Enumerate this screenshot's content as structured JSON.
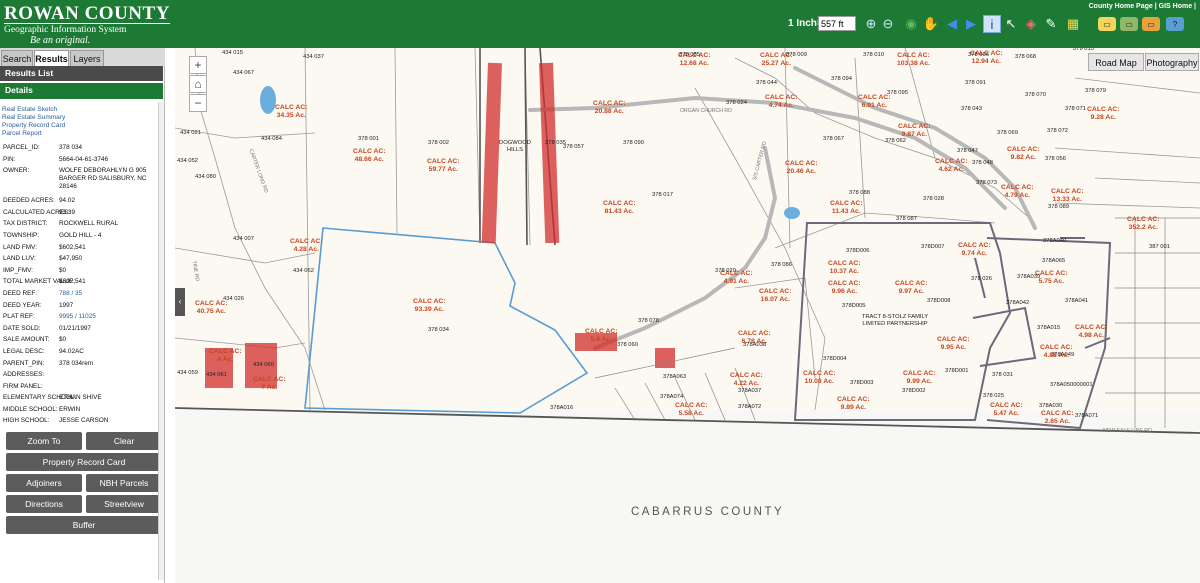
{
  "header": {
    "logo_line1": "ROWAN COUNTY",
    "logo_line2": "Geographic Information System",
    "logo_line3": "Be an original.",
    "top_links": "County Home Page | GIS Home |",
    "scale_label": "1 Inch=",
    "scale_value": "557 ft"
  },
  "toolbar": [
    {
      "name": "zoom-in-icon",
      "glyph": "⊕",
      "color": "#cfe8ff"
    },
    {
      "name": "zoom-out-icon",
      "glyph": "⊖",
      "color": "#cfe8ff"
    },
    {
      "name": "globe-icon",
      "glyph": "◉",
      "color": "#5fb85f"
    },
    {
      "name": "pan-hand-icon",
      "glyph": "✋",
      "color": "#fff"
    },
    {
      "name": "back-arrow-icon",
      "glyph": "◀",
      "color": "#3f8fe8"
    },
    {
      "name": "forward-arrow-icon",
      "glyph": "▶",
      "color": "#3f8fe8"
    },
    {
      "name": "identify-icon",
      "glyph": "i",
      "color": "#1a4f8c"
    },
    {
      "name": "select-arrow-icon",
      "glyph": "↖",
      "color": "#fff"
    },
    {
      "name": "eraser-icon",
      "glyph": "◈",
      "color": "#ff6b6b"
    },
    {
      "name": "pencil-icon",
      "glyph": "✎",
      "color": "#fff"
    },
    {
      "name": "map-icon",
      "glyph": "▦",
      "color": "#ffd24a"
    }
  ],
  "tabs": [
    "Search",
    "Results",
    "Layers"
  ],
  "panel": {
    "results_list": "Results List",
    "details": "Details",
    "links": [
      "Real Estate Sketch",
      "Real Estate Summary",
      "Property Record Card",
      "Parcel Report"
    ]
  },
  "attributes": [
    {
      "k": "PARCEL_ID:",
      "v": "378 034"
    },
    {
      "k": "PIN:",
      "v": "5664-04-61-3746"
    },
    {
      "k": "OWNER:",
      "v": "WOLFE DEBORAHLYN G 905 BARGER RD SALISBURY, NC 28146",
      "tall": true
    },
    {
      "k": "DEEDED ACRES:",
      "v": "94.02"
    },
    {
      "k": "CALCULATED ACRES:",
      "v": "93.39"
    },
    {
      "k": "TAX DISTRICT:",
      "v": "ROCKWELL RURAL"
    },
    {
      "k": "TOWNSHIP:",
      "v": "GOLD HILL - 4"
    },
    {
      "k": "LAND FMV:",
      "v": "$602,541"
    },
    {
      "k": "LAND LUV:",
      "v": "$47,950"
    },
    {
      "k": "IMP_FMV:",
      "v": "$0"
    },
    {
      "k": "TOTAL MARKET VALUE:",
      "v": "$602,541"
    },
    {
      "k": "DEED REF:",
      "v": "788 / 35",
      "link": true
    },
    {
      "k": "DEED YEAR:",
      "v": "1997"
    },
    {
      "k": "PLAT REF:",
      "v": "9995 / 11025",
      "link": true
    },
    {
      "k": "DATE SOLD:",
      "v": "01/21/1997"
    },
    {
      "k": "SALE AMOUNT:",
      "v": "$0"
    },
    {
      "k": "LEGAL DESC:",
      "v": "94.02AC"
    },
    {
      "k": "PARENT_PIN:",
      "v": "378 034rem"
    },
    {
      "k": "ADDRESSES:",
      "v": ""
    },
    {
      "k": "FIRM PANEL:",
      "v": ""
    },
    {
      "k": "ELEMENTARY SCHOOL:",
      "v": "ETHAN SHIVE"
    },
    {
      "k": "MIDDLE SCHOOL:",
      "v": "ERWIN"
    },
    {
      "k": "HIGH SCHOOL:",
      "v": "JESSE CARSON"
    }
  ],
  "buttons": {
    "zoom_to": "Zoom To",
    "clear": "Clear",
    "property_record_card": "Property Record Card",
    "adjoiners": "Adjoiners",
    "nbh_parcels": "NBH Parcels",
    "directions": "Directions",
    "streetview": "Streetview",
    "buffer": "Buffer"
  },
  "basemap": {
    "road": "Road Map",
    "photo": "Photography"
  },
  "map": {
    "county": "CABARRUS COUNTY",
    "dogwood": "DOGWOOD HILLS",
    "tract": "TRACT 8-STOLZ FAMILY LIMITED PARTNERSHIP",
    "calc": [
      [
        "CALC AC:",
        "12.68 Ac."
      ],
      [
        "CALC AC:",
        "25.27 Ac."
      ],
      [
        "CALC AC:",
        "103.38 Ac."
      ],
      [
        "CALC AC:",
        "12.94 Ac."
      ],
      [
        "CALC AC:",
        "34.35 Ac."
      ],
      [
        "CALC AC:",
        "48.66 Ac."
      ],
      [
        "CALC AC:",
        "59.77 Ac."
      ],
      [
        "CALC AC:",
        "20.88 Ac."
      ],
      [
        "CALC AC:",
        "4.74 Ac."
      ],
      [
        "CALC AC:",
        "6.91 Ac."
      ],
      [
        "CALC AC:",
        "9.87 Ac."
      ],
      [
        "CALC AC:",
        "9.28 Ac."
      ],
      [
        "CALC AC:",
        "9.82 Ac."
      ],
      [
        "CALC AC:",
        "20.46 Ac."
      ],
      [
        "CALC AC:",
        "4.62 Ac."
      ],
      [
        "CALC AC:",
        "81.43 Ac."
      ],
      [
        "CALC AC:",
        "11.43 Ac."
      ],
      [
        "CALC AC:",
        "4.79 Ac."
      ],
      [
        "CALC AC:",
        "13.33 Ac."
      ],
      [
        "CALC AC:",
        "352.2 Ac."
      ],
      [
        "CALC AC:",
        "4.28 Ac."
      ],
      [
        "CALC AC:",
        "10.37 Ac."
      ],
      [
        "CALC AC:",
        "9.74 Ac."
      ],
      [
        "CALC AC:",
        "4.91 Ac."
      ],
      [
        "CALC AC:",
        "9.96 Ac."
      ],
      [
        "CALC AC:",
        "9.97 Ac."
      ],
      [
        "CALC AC:",
        "5.75 Ac."
      ],
      [
        "CALC AC:",
        "16.07 Ac."
      ],
      [
        "CALC AC:",
        "40.75 Ac."
      ],
      [
        "CALC AC:",
        "93.39 Ac."
      ],
      [
        "CALC AC:",
        "4.98 Ac."
      ],
      [
        "CALC AC:",
        "6.78 Ac."
      ],
      [
        "CALC AC:",
        "9.95 Ac."
      ],
      [
        "CALC AC:",
        "4.88 Ac."
      ],
      [
        "CALC AC:",
        "4 Ac."
      ],
      [
        "CALC AC:",
        "7 Ac."
      ],
      [
        "CALC AC:",
        "4.22 Ac."
      ],
      [
        "CALC AC:",
        "10.08 Ac."
      ],
      [
        "CALC AC:",
        "9.99 Ac."
      ],
      [
        "CALC AC:",
        "5.58 Ac."
      ],
      [
        "CALC AC:",
        "9.89 Ac."
      ],
      [
        "CALC AC:",
        "5.47 Ac."
      ],
      [
        "CALC AC:",
        "2.65 Ac."
      ],
      [
        "CALC AC:",
        "5.4 Ac."
      ]
    ],
    "pids": [
      "434 015",
      "434 037",
      "434 067",
      "378 085",
      "378 009",
      "378 010",
      "378 096",
      "378 068",
      "379 013",
      "378 044",
      "378 094",
      "378 091",
      "378 070",
      "378 079",
      "378 024",
      "378 095",
      "378 043",
      "378 071",
      "434 021",
      "434 084",
      "378 001",
      "378 002",
      "378 035",
      "378 057",
      "378 090",
      "378 067",
      "378 062",
      "378 069",
      "378 072",
      "378 047",
      "378 048",
      "378 056",
      "434 052",
      "434 080",
      "378 017",
      "378 073",
      "378 088",
      "378 028",
      "378 089",
      "378 087",
      "434 007",
      "434 062",
      "378D006",
      "378D007",
      "378A040",
      "387 001",
      "378 029",
      "378 086",
      "378 026",
      "378A065",
      "378A039",
      "378D005",
      "378D008",
      "378A042",
      "378A041",
      "434 026",
      "378 034",
      "378 078",
      "378 060",
      "378A015",
      "378A038",
      "378D004",
      "378D001",
      "378A049",
      "434 059",
      "434 061",
      "434 060",
      "378A063",
      "378A037",
      "378D003",
      "378D002",
      "378 031",
      "378A050000001",
      "378 025",
      "378A074",
      "378A072",
      "378A016",
      "378A030",
      "378A071"
    ],
    "roads": [
      "CARTER LONG RD",
      "ORGAN CHURCH RD",
      "SIS CARTER RD",
      "NEW SALE LINE RD",
      "TINE RD"
    ]
  }
}
